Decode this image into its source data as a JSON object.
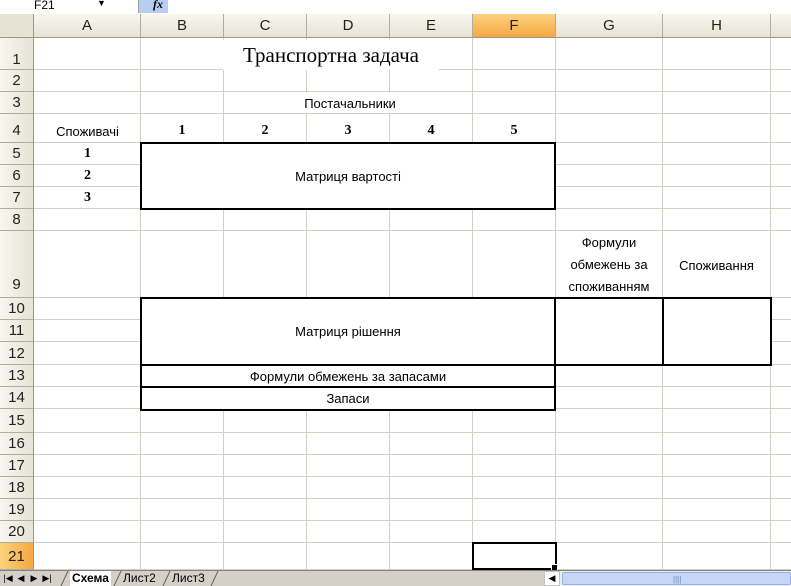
{
  "name_box": {
    "value": "F21"
  },
  "formula_bar": {
    "fx_label": "fx",
    "value": ""
  },
  "columns": [
    "A",
    "B",
    "C",
    "D",
    "E",
    "F",
    "G",
    "H"
  ],
  "active_column": "F",
  "rows": [
    "1",
    "2",
    "3",
    "4",
    "5",
    "6",
    "7",
    "8",
    "9",
    "10",
    "11",
    "12",
    "13",
    "14",
    "15",
    "16",
    "17",
    "18",
    "19",
    "20",
    "21"
  ],
  "active_row": "21",
  "cells": {
    "title": "Транспортна задача",
    "suppliers_header": "Постачальники",
    "consumers_header": "Споживачі",
    "supplier_numbers": [
      "1",
      "2",
      "3",
      "4",
      "5"
    ],
    "consumer_numbers": [
      "1",
      "2",
      "3"
    ],
    "cost_matrix": "Матриця вартості",
    "consumption_formulas": "Формули обмежень за споживанням",
    "consumption": "Споживання",
    "solution_matrix": "Матриця рішення",
    "stock_formulas": "Формули обмежень за запасами",
    "stock": "Запаси"
  },
  "sheet_tabs": [
    "Схема",
    "Лист2",
    "Лист3"
  ],
  "active_sheet": "Схема"
}
